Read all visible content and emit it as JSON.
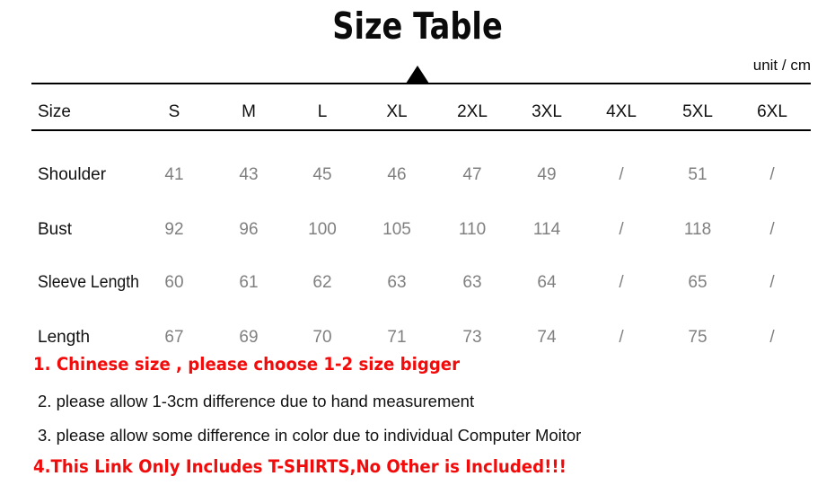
{
  "title": "Size Table",
  "unit_label": "unit / cm",
  "colors": {
    "title": "#0b0b0b",
    "label": "#111111",
    "value": "#808080",
    "note_red": "#f20b0b",
    "rule": "#000000"
  },
  "table": {
    "corner_label": "Size",
    "columns": [
      "S",
      "M",
      "L",
      "XL",
      "2XL",
      "3XL",
      "4XL",
      "5XL",
      "6XL"
    ],
    "rows": [
      {
        "label": "Shoulder",
        "values": [
          "41",
          "43",
          "45",
          "46",
          "47",
          "49",
          "/",
          "51",
          "/"
        ]
      },
      {
        "label": "Bust",
        "values": [
          "92",
          "96",
          "100",
          "105",
          "110",
          "114",
          "/",
          "118",
          "/"
        ]
      },
      {
        "label": "Sleeve Length",
        "values": [
          "60",
          "61",
          "62",
          "63",
          "63",
          "64",
          "/",
          "65",
          "/"
        ]
      },
      {
        "label": "Length",
        "values": [
          "67",
          "69",
          "70",
          "71",
          "73",
          "74",
          "/",
          "75",
          "/"
        ]
      }
    ]
  },
  "notes": [
    {
      "text": "1. Chinese size , please choose 1-2 size bigger",
      "style": "red"
    },
    {
      "text": "2. please allow 1-3cm difference due to hand measurement",
      "style": "plain"
    },
    {
      "text": "3. please allow some difference in color due to individual Computer Moitor",
      "style": "plain"
    },
    {
      "text": "4.This Link Only Includes T-SHIRTS,No Other is Included!!!",
      "style": "red"
    }
  ]
}
